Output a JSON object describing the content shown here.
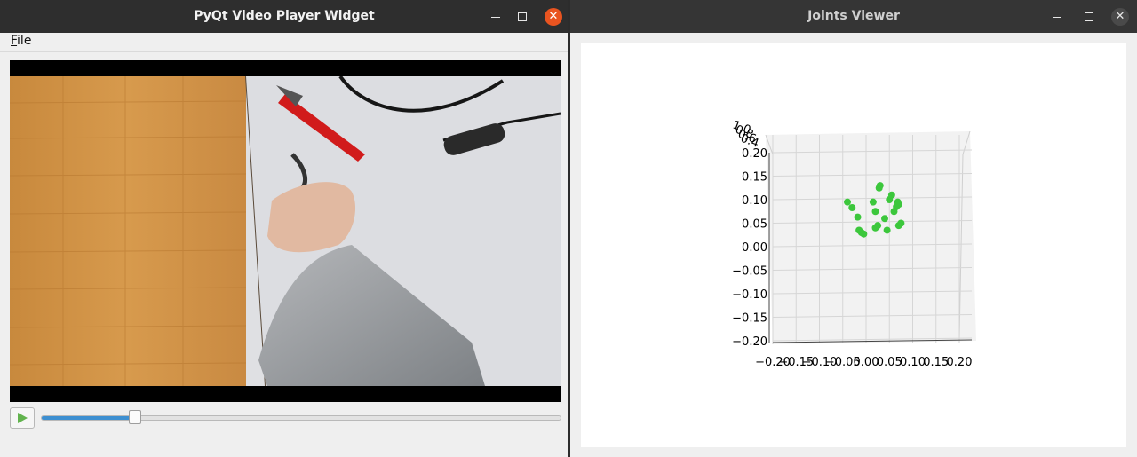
{
  "left_window": {
    "title": "PyQt Video Player Widget",
    "menu": {
      "file_label": "File"
    },
    "controls": {
      "position_fraction": 0.18
    }
  },
  "right_window": {
    "title": "Joints Viewer",
    "chart_data": {
      "type": "scatter",
      "projection": "3d",
      "grid": true,
      "color": "#3cc73c",
      "xlim": [
        -0.2,
        0.2
      ],
      "ylim": [
        -0.2,
        0.2
      ],
      "x_ticks": [
        "−0.20",
        "−0.15",
        "−0.10",
        "−0.05",
        "0.00",
        "0.05",
        "0.10",
        "0.15",
        "0.20"
      ],
      "y_ticks": [
        "0.20",
        "0.15",
        "0.10",
        "0.05",
        "0.00",
        "−0.05",
        "−0.10",
        "−0.15",
        "−0.20"
      ],
      "z_ticks": [
        "1.0",
        "0.8",
        "0.6",
        "0.4"
      ],
      "points": [
        {
          "x": -0.04,
          "y": 0.095
        },
        {
          "x": -0.03,
          "y": 0.083
        },
        {
          "x": -0.018,
          "y": 0.063
        },
        {
          "x": -0.015,
          "y": 0.035
        },
        {
          "x": -0.01,
          "y": 0.03
        },
        {
          "x": -0.005,
          "y": 0.027
        },
        {
          "x": 0.015,
          "y": 0.095
        },
        {
          "x": 0.02,
          "y": 0.075
        },
        {
          "x": 0.025,
          "y": 0.045
        },
        {
          "x": 0.028,
          "y": 0.125
        },
        {
          "x": 0.03,
          "y": 0.13
        },
        {
          "x": 0.02,
          "y": 0.04
        },
        {
          "x": 0.04,
          "y": 0.06
        },
        {
          "x": 0.045,
          "y": 0.035
        },
        {
          "x": 0.05,
          "y": 0.1
        },
        {
          "x": 0.055,
          "y": 0.11
        },
        {
          "x": 0.06,
          "y": 0.075
        },
        {
          "x": 0.065,
          "y": 0.085
        },
        {
          "x": 0.068,
          "y": 0.095
        },
        {
          "x": 0.07,
          "y": 0.09
        },
        {
          "x": 0.07,
          "y": 0.045
        },
        {
          "x": 0.075,
          "y": 0.05
        }
      ]
    }
  }
}
